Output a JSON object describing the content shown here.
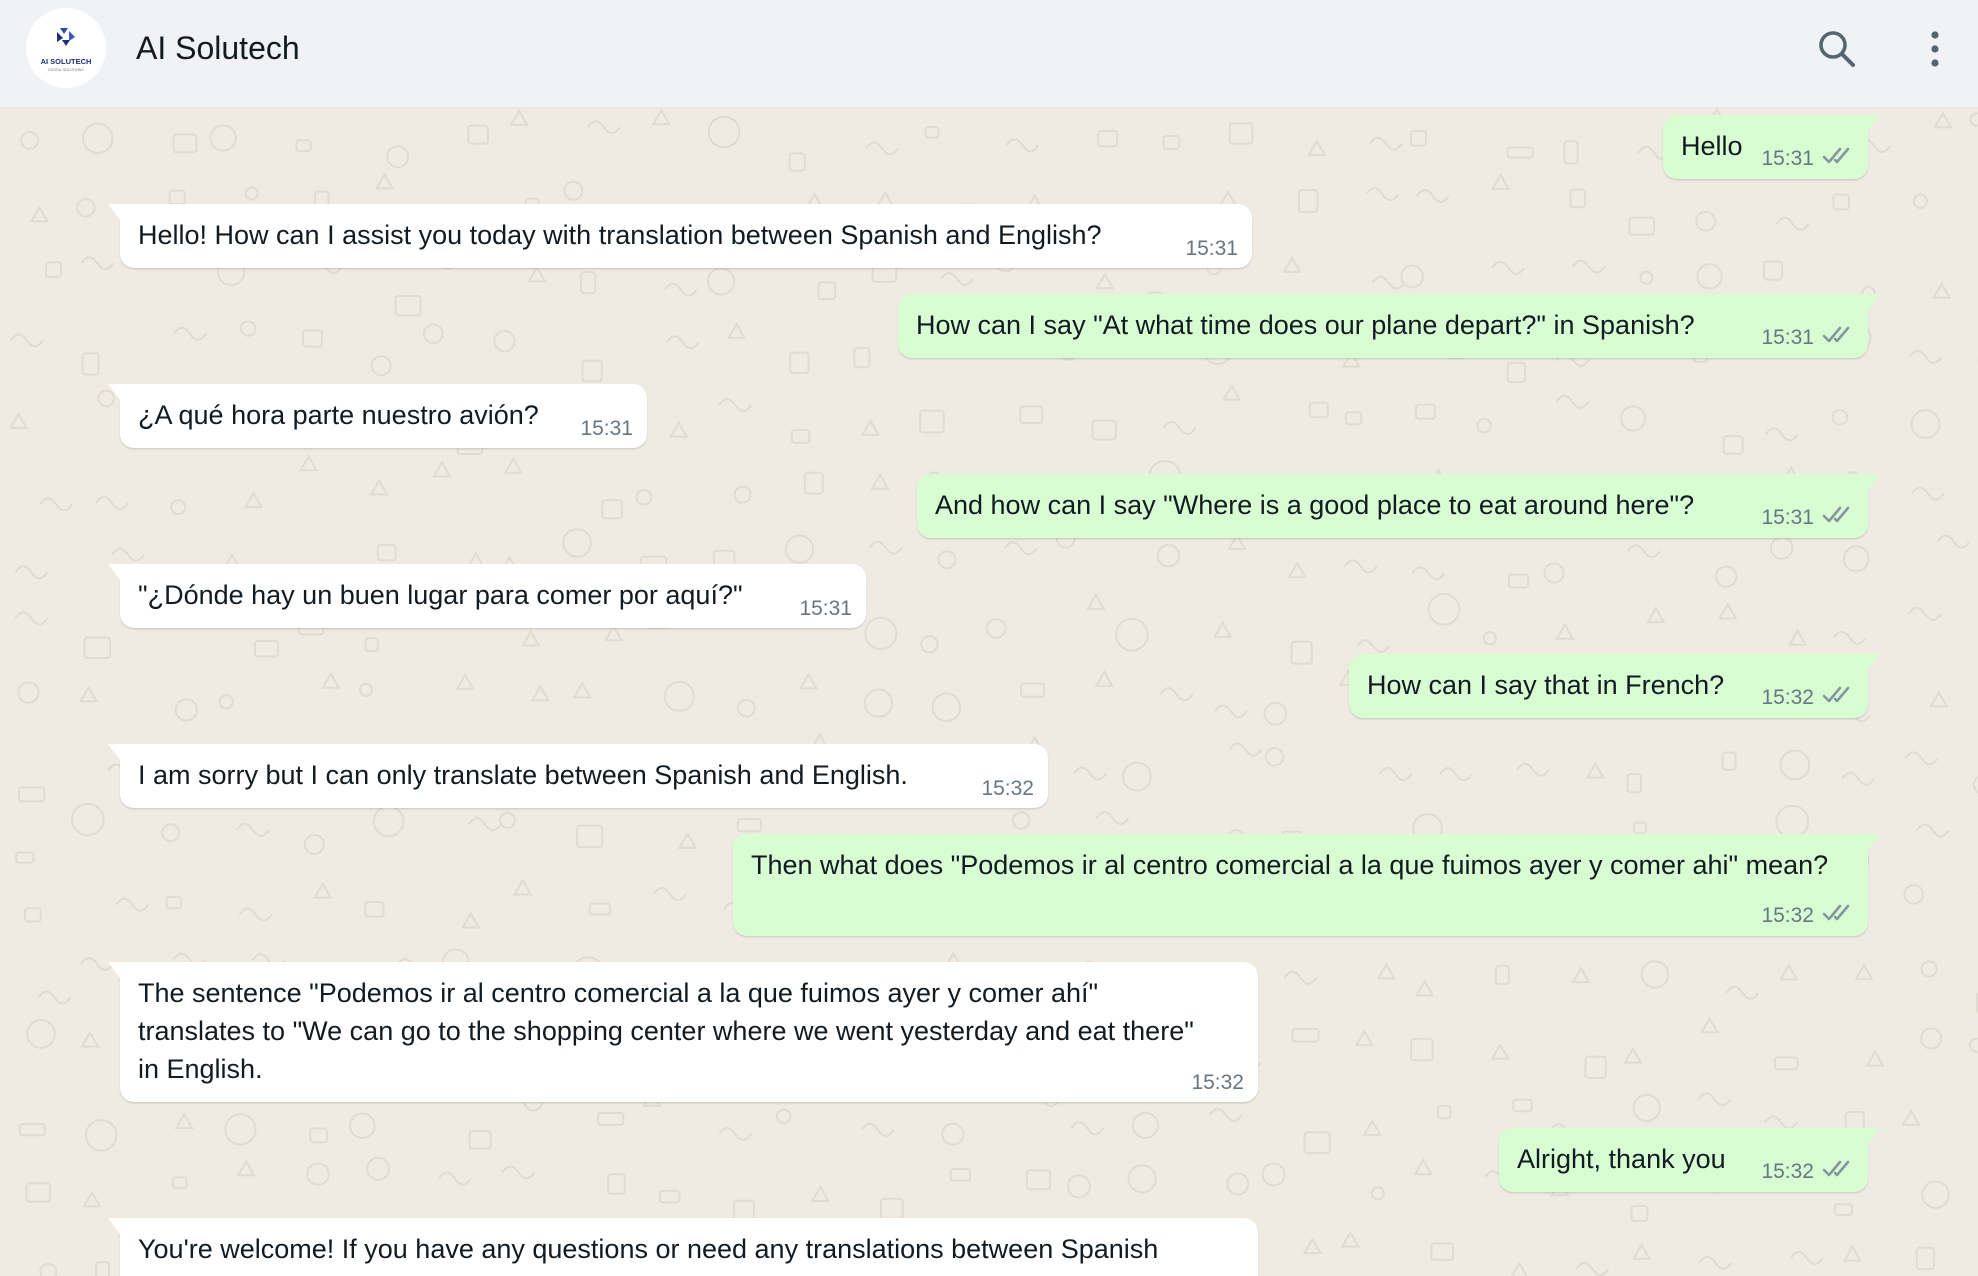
{
  "header": {
    "title": "AI Solutech",
    "avatar_text_line1": "AI SOLUTECH",
    "avatar_text_line2": "DIGITAL SOLUTIONS",
    "search_icon": "search-icon",
    "menu_icon": "kebab-menu-icon"
  },
  "colors": {
    "header_bg": "#f0f2f5",
    "chat_bg": "#efeae2",
    "incoming_bubble": "#ffffff",
    "outgoing_bubble": "#d9fdd3",
    "timestamp": "#667781",
    "read_tick": "#8696a0"
  },
  "messages": [
    {
      "direction": "out",
      "text": "Hello",
      "time": "15:31",
      "status": "read"
    },
    {
      "direction": "in",
      "text": "Hello! How can I assist you today with translation between Spanish and English?",
      "time": "15:31"
    },
    {
      "direction": "out",
      "text": "How can I say \"At what time does our plane depart?\" in Spanish?",
      "time": "15:31",
      "status": "read"
    },
    {
      "direction": "in",
      "text": "¿A qué hora parte nuestro avión?",
      "time": "15:31"
    },
    {
      "direction": "out",
      "text": "And how can I say \"Where is a good place to eat around here\"?",
      "time": "15:31",
      "status": "read"
    },
    {
      "direction": "in",
      "text": "\"¿Dónde hay un buen lugar para comer por aquí?\"",
      "time": "15:31"
    },
    {
      "direction": "out",
      "text": "How can I say that in French?",
      "time": "15:32",
      "status": "read"
    },
    {
      "direction": "in",
      "text": "I am sorry but I can only translate between Spanish and English.",
      "time": "15:32"
    },
    {
      "direction": "out",
      "text": "Then what does \"Podemos ir al centro comercial a la que fuimos ayer y comer ahi\" mean?",
      "time": "15:32",
      "status": "read"
    },
    {
      "direction": "in",
      "text": "The sentence \"Podemos ir al centro comercial a la que fuimos ayer y comer ahí\" translates to \"We can go to the shopping center where we went yesterday and eat there\" in English.",
      "time": "15:32"
    },
    {
      "direction": "out",
      "text": "Alright, thank you",
      "time": "15:32",
      "status": "read"
    },
    {
      "direction": "in",
      "text": "You're welcome! If you have any questions or need any translations between Spanish",
      "time": ""
    }
  ]
}
